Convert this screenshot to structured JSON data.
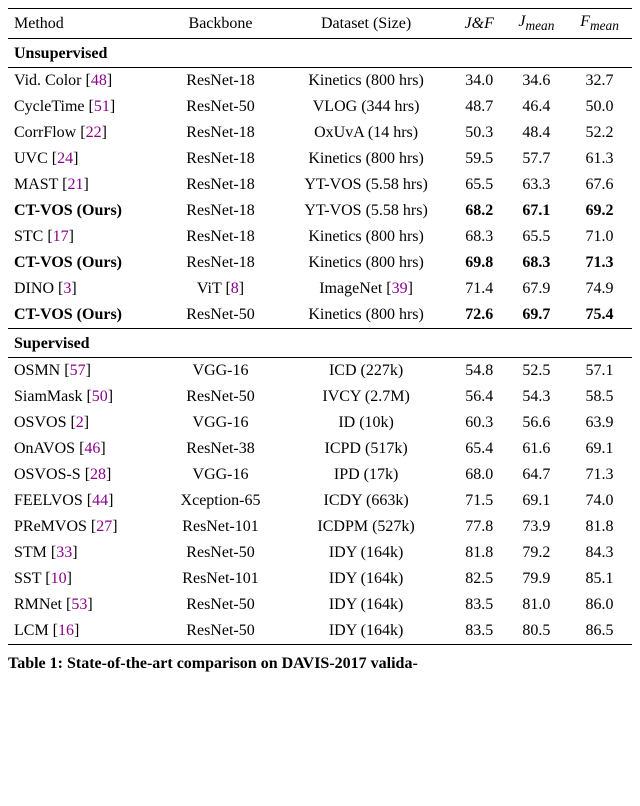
{
  "headers": {
    "method": "Method",
    "backbone": "Backbone",
    "dataset": "Dataset (Size)",
    "jf": "J&F",
    "jmean": "J",
    "jmean_sub": "mean",
    "fmean": "F",
    "fmean_sub": "mean"
  },
  "sections": {
    "unsupervised": "Unsupervised",
    "supervised": "Supervised"
  },
  "unsup_rows": [
    {
      "method": "Vid. Color",
      "cite": "48",
      "backbone": "ResNet-18",
      "dataset": "Kinetics (800 hrs)",
      "jf": "34.0",
      "jmean": "34.6",
      "fmean": "32.7",
      "bold": false
    },
    {
      "method": "CycleTime",
      "cite": "51",
      "backbone": "ResNet-50",
      "dataset": "VLOG (344 hrs)",
      "jf": "48.7",
      "jmean": "46.4",
      "fmean": "50.0",
      "bold": false
    },
    {
      "method": "CorrFlow",
      "cite": "22",
      "backbone": "ResNet-18",
      "dataset": "OxUvA (14 hrs)",
      "jf": "50.3",
      "jmean": "48.4",
      "fmean": "52.2",
      "bold": false
    },
    {
      "method": "UVC",
      "cite": "24",
      "backbone": "ResNet-18",
      "dataset": "Kinetics (800 hrs)",
      "jf": "59.5",
      "jmean": "57.7",
      "fmean": "61.3",
      "bold": false
    },
    {
      "method": "MAST",
      "cite": "21",
      "backbone": "ResNet-18",
      "dataset": "YT-VOS (5.58 hrs)",
      "jf": "65.5",
      "jmean": "63.3",
      "fmean": "67.6",
      "bold": false
    },
    {
      "method": "CT-VOS (Ours)",
      "cite": "",
      "backbone": "ResNet-18",
      "dataset": "YT-VOS (5.58 hrs)",
      "jf": "68.2",
      "jmean": "67.1",
      "fmean": "69.2",
      "bold": true
    },
    {
      "method": "STC",
      "cite": "17",
      "backbone": "ResNet-18",
      "dataset": "Kinetics (800 hrs)",
      "jf": "68.3",
      "jmean": "65.5",
      "fmean": "71.0",
      "bold": false
    },
    {
      "method": "CT-VOS (Ours)",
      "cite": "",
      "backbone": "ResNet-18",
      "dataset": "Kinetics (800 hrs)",
      "jf": "69.8",
      "jmean": "68.3",
      "fmean": "71.3",
      "bold": true
    },
    {
      "method": "DINO",
      "cite": "3",
      "backbone_text": "ViT",
      "backbone_cite": "8",
      "dataset_text": "ImageNet",
      "dataset_cite": "39",
      "jf": "71.4",
      "jmean": "67.9",
      "fmean": "74.9",
      "bold": false,
      "special": true
    },
    {
      "method": "CT-VOS (Ours)",
      "cite": "",
      "backbone": "ResNet-50",
      "dataset": "Kinetics (800 hrs)",
      "jf": "72.6",
      "jmean": "69.7",
      "fmean": "75.4",
      "bold": true
    }
  ],
  "sup_rows": [
    {
      "method": "OSMN",
      "cite": "57",
      "backbone": "VGG-16",
      "dataset": "ICD (227k)",
      "jf": "54.8",
      "jmean": "52.5",
      "fmean": "57.1"
    },
    {
      "method": "SiamMask",
      "cite": "50",
      "backbone": "ResNet-50",
      "dataset": "IVCY (2.7M)",
      "jf": "56.4",
      "jmean": "54.3",
      "fmean": "58.5"
    },
    {
      "method": "OSVOS",
      "cite": "2",
      "backbone": "VGG-16",
      "dataset": "ID (10k)",
      "jf": "60.3",
      "jmean": "56.6",
      "fmean": "63.9"
    },
    {
      "method": "OnAVOS",
      "cite": "46",
      "backbone": "ResNet-38",
      "dataset": "ICPD (517k)",
      "jf": "65.4",
      "jmean": "61.6",
      "fmean": "69.1"
    },
    {
      "method": "OSVOS-S",
      "cite": "28",
      "backbone": "VGG-16",
      "dataset": "IPD (17k)",
      "jf": "68.0",
      "jmean": "64.7",
      "fmean": "71.3"
    },
    {
      "method": "FEELVOS",
      "cite": "44",
      "backbone": "Xception-65",
      "dataset": "ICDY (663k)",
      "jf": "71.5",
      "jmean": "69.1",
      "fmean": "74.0"
    },
    {
      "method": "PReMVOS",
      "cite": "27",
      "backbone": "ResNet-101",
      "dataset": "ICDPM (527k)",
      "jf": "77.8",
      "jmean": "73.9",
      "fmean": "81.8"
    },
    {
      "method": "STM",
      "cite": "33",
      "backbone": "ResNet-50",
      "dataset": "IDY (164k)",
      "jf": "81.8",
      "jmean": "79.2",
      "fmean": "84.3"
    },
    {
      "method": "SST",
      "cite": "10",
      "backbone": "ResNet-101",
      "dataset": "IDY (164k)",
      "jf": "82.5",
      "jmean": "79.9",
      "fmean": "85.1"
    },
    {
      "method": "RMNet",
      "cite": "53",
      "backbone": "ResNet-50",
      "dataset": "IDY (164k)",
      "jf": "83.5",
      "jmean": "81.0",
      "fmean": "86.0"
    },
    {
      "method": "LCM",
      "cite": "16",
      "backbone": "ResNet-50",
      "dataset": "IDY (164k)",
      "jf": "83.5",
      "jmean": "80.5",
      "fmean": "86.5"
    }
  ],
  "caption_prefix": "Table 1: State-of-the-art comparison on DAVIS-2017 valida-"
}
